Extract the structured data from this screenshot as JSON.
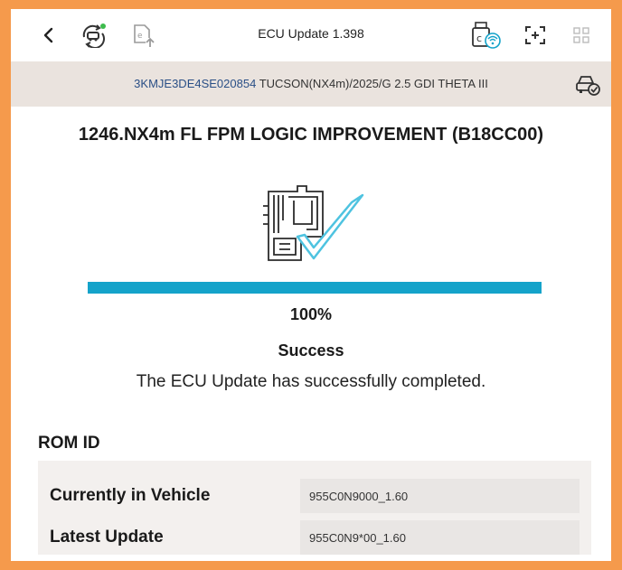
{
  "header": {
    "title": "ECU Update 1.398",
    "icons": [
      "back-arrow-icon",
      "vehicle-check-icon",
      "document-upload-icon",
      "vci-wireless-icon",
      "fullscreen-icon",
      "grid-icon"
    ]
  },
  "vehicle": {
    "vin": "3KMJE3DE4SE020854",
    "description": "TUCSON(NX4m)/2025/G 2.5 GDI THETA III",
    "icon": "vehicle-status-icon"
  },
  "update": {
    "title": "1246.NX4m FL FPM LOGIC IMPROVEMENT (B18CC00)",
    "progress": 100,
    "progress_label": "100%",
    "status_title": "Success",
    "status_message": "The ECU Update has successfully completed."
  },
  "rom": {
    "heading": "ROM ID",
    "rows": [
      {
        "label": "Currently in Vehicle",
        "value": "955C0N9000_1.60"
      },
      {
        "label": "Latest Update",
        "value": "955C0N9*00_1.60"
      }
    ]
  },
  "colors": {
    "frame": "#F59A4C",
    "progress": "#14A3CA",
    "info_bar": "#EAE3DE",
    "vin_text": "#2A4F86",
    "check_icon": "#4EC3E0",
    "badge_green": "#3DBB4C"
  }
}
